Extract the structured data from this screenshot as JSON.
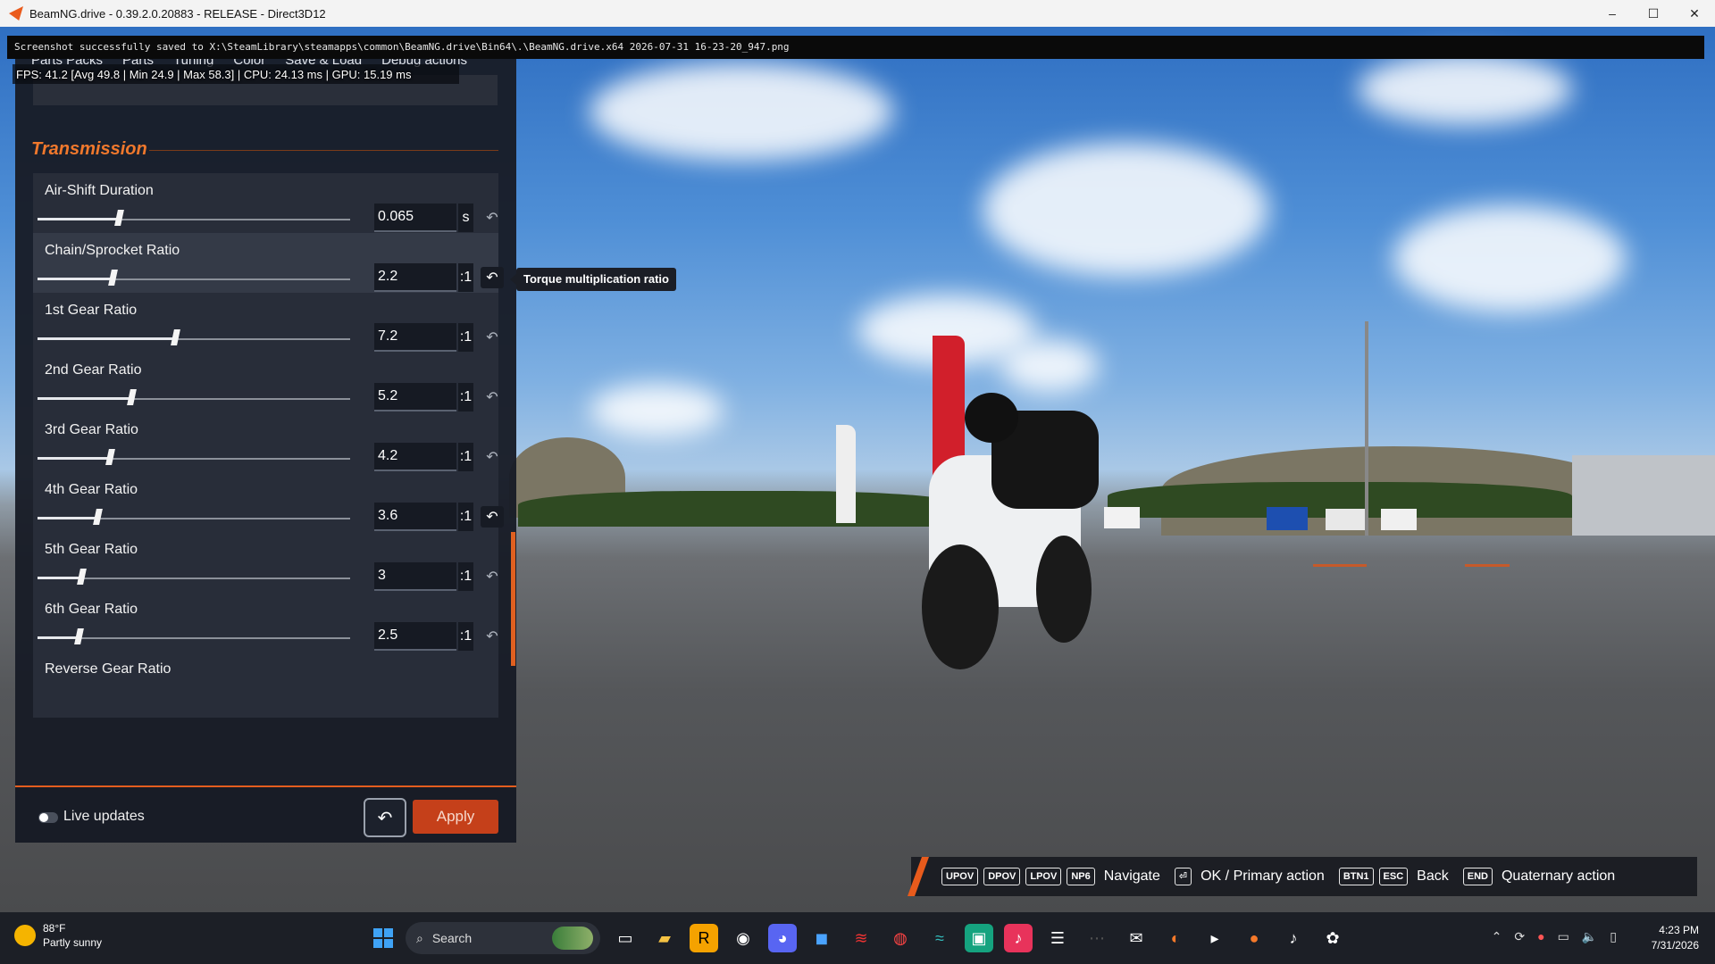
{
  "window": {
    "title": "BeamNG.drive - 0.39.2.0.20883 - RELEASE - Direct3D12",
    "controls": [
      "–",
      "☐",
      "✕"
    ]
  },
  "console": {
    "message": "Screenshot successfully saved to X:\\SteamLibrary\\steamapps\\common\\BeamNG.drive\\Bin64\\.\\BeamNG.drive.x64 2026-07-31 16-23-20_947.png"
  },
  "stats": {
    "fps": "FPS:  41.2 [Avg  49.8 | Min  24.9 | Max  58.3] | CPU: 24.13 ms | GPU: 15.19 ms"
  },
  "tabs": [
    "Parts Packs",
    "Parts",
    "Tuning",
    "Color",
    "Save & Load",
    "Debug actions"
  ],
  "section": {
    "title": "Transmission"
  },
  "tooltip": "Torque multiplication ratio",
  "rows": [
    {
      "label": "Air-Shift Duration",
      "value": "0.065",
      "unit": "s",
      "slider": 0.26
    },
    {
      "label": "Chain/Sprocket Ratio",
      "value": "2.2",
      "unit": ":1",
      "slider": 0.24
    },
    {
      "label": "1st Gear Ratio",
      "value": "7.2",
      "unit": ":1",
      "slider": 0.44
    },
    {
      "label": "2nd Gear Ratio",
      "value": "5.2",
      "unit": ":1",
      "slider": 0.3
    },
    {
      "label": "3rd Gear Ratio",
      "value": "4.2",
      "unit": ":1",
      "slider": 0.23
    },
    {
      "label": "4th Gear Ratio",
      "value": "3.6",
      "unit": ":1",
      "slider": 0.19
    },
    {
      "label": "5th Gear Ratio",
      "value": "3",
      "unit": ":1",
      "slider": 0.14
    },
    {
      "label": "6th Gear Ratio",
      "value": "2.5",
      "unit": ":1",
      "slider": 0.13
    },
    {
      "label": "Reverse Gear Ratio"
    }
  ],
  "footer": {
    "live_updates": "Live updates",
    "undo_icon": "↶",
    "apply": "Apply"
  },
  "hints": [
    {
      "keys": [
        "UPOV",
        "DPOV",
        "LPOV",
        "NP6"
      ],
      "text": "Navigate"
    },
    {
      "keys": [
        "⏎"
      ],
      "text": "OK / Primary action"
    },
    {
      "keys": [
        "BTN1",
        "ESC"
      ],
      "text": "Back"
    },
    {
      "keys": [
        "END"
      ],
      "text": "Quaternary action"
    }
  ],
  "taskbar": {
    "weather_temp": "88°F",
    "weather_desc": "Partly sunny",
    "search_placeholder": "Search",
    "time": "4:23 PM",
    "date": "7/31/2026"
  },
  "colors": {
    "accent": "#e45d1e",
    "panel_bg": "#181c26"
  }
}
